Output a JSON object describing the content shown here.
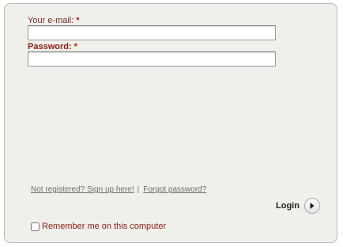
{
  "form": {
    "email": {
      "label": "Your e-mail:",
      "required_mark": "*",
      "value": "",
      "placeholder": ""
    },
    "password": {
      "label": "Password:",
      "required_mark": "*",
      "value": "",
      "placeholder": ""
    },
    "links": {
      "signup": "Not registered? Sign up here!",
      "separator": "|",
      "forgot": "Forgot password?"
    },
    "login": {
      "label": "Login",
      "icon": "arrow-right-icon"
    },
    "remember": {
      "label": "Remember me on this computer",
      "checked": false
    }
  },
  "colors": {
    "panel_background": "#efefeb",
    "label_red": "#8a1f14",
    "required_red": "#b0180c",
    "link_gray": "#6d6d6d"
  }
}
